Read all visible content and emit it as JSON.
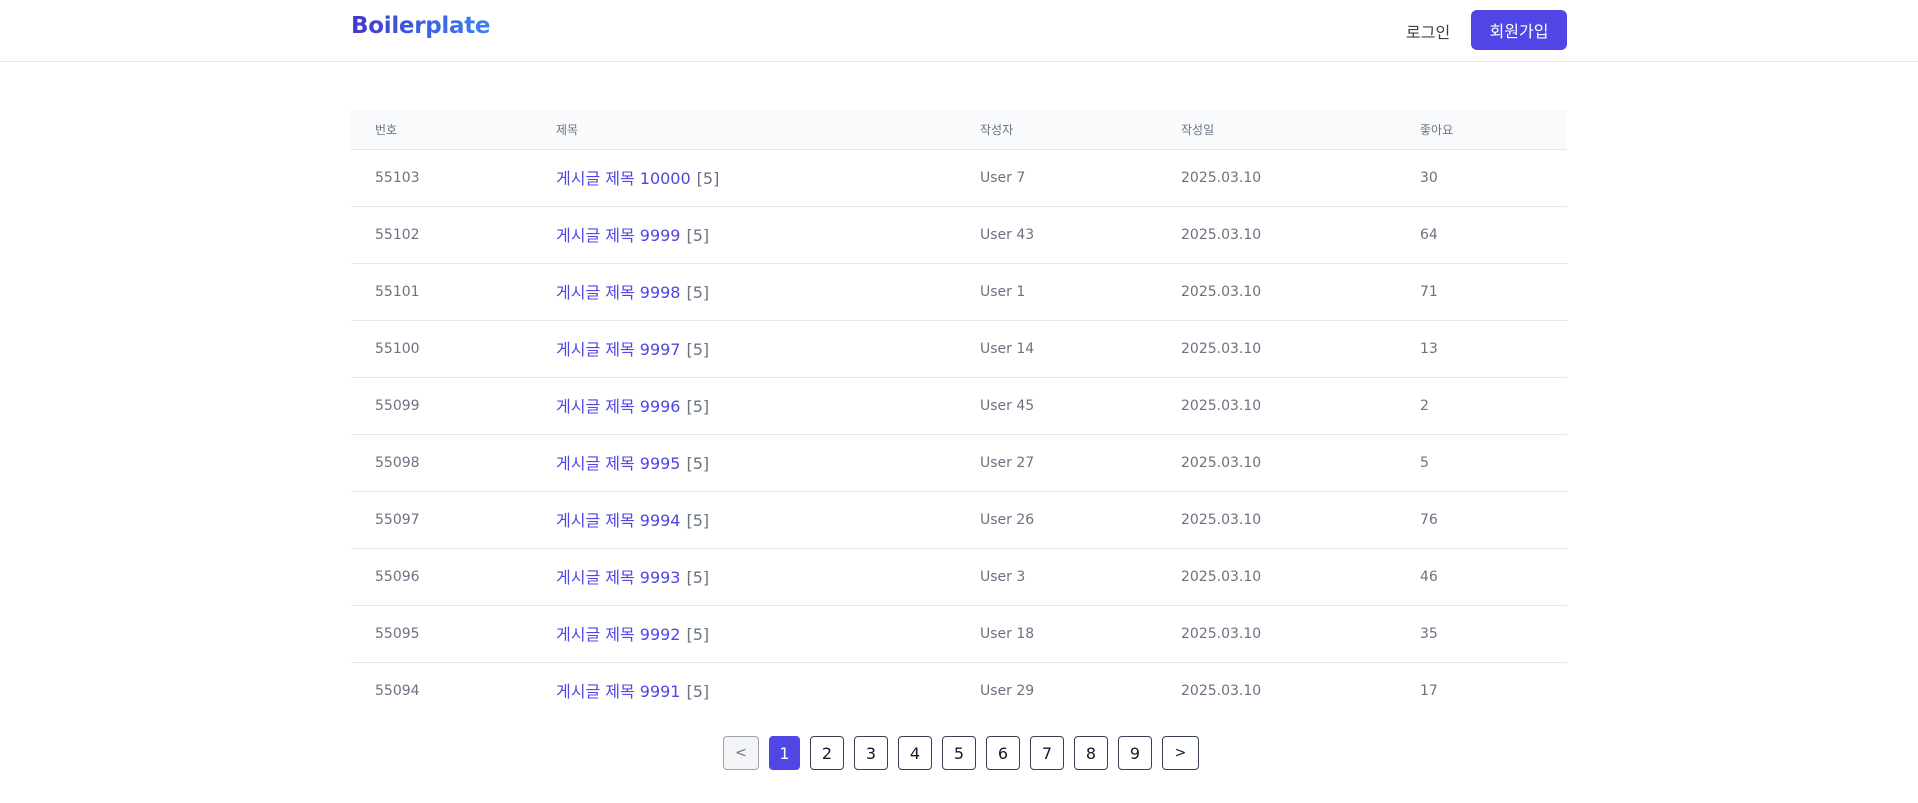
{
  "header": {
    "logo": "Boilerplate",
    "login_label": "로그인",
    "signup_label": "회원가입"
  },
  "table": {
    "columns": [
      "번호",
      "제목",
      "작성자",
      "작성일",
      "좋아요"
    ],
    "rows": [
      {
        "num": "55103",
        "title": "게시글 제목 10000",
        "comments": "[5]",
        "author": "User 7",
        "date": "2025.03.10",
        "likes": "30"
      },
      {
        "num": "55102",
        "title": "게시글 제목 9999",
        "comments": "[5]",
        "author": "User 43",
        "date": "2025.03.10",
        "likes": "64"
      },
      {
        "num": "55101",
        "title": "게시글 제목 9998",
        "comments": "[5]",
        "author": "User 1",
        "date": "2025.03.10",
        "likes": "71"
      },
      {
        "num": "55100",
        "title": "게시글 제목 9997",
        "comments": "[5]",
        "author": "User 14",
        "date": "2025.03.10",
        "likes": "13"
      },
      {
        "num": "55099",
        "title": "게시글 제목 9996",
        "comments": "[5]",
        "author": "User 45",
        "date": "2025.03.10",
        "likes": "2"
      },
      {
        "num": "55098",
        "title": "게시글 제목 9995",
        "comments": "[5]",
        "author": "User 27",
        "date": "2025.03.10",
        "likes": "5"
      },
      {
        "num": "55097",
        "title": "게시글 제목 9994",
        "comments": "[5]",
        "author": "User 26",
        "date": "2025.03.10",
        "likes": "76"
      },
      {
        "num": "55096",
        "title": "게시글 제목 9993",
        "comments": "[5]",
        "author": "User 3",
        "date": "2025.03.10",
        "likes": "46"
      },
      {
        "num": "55095",
        "title": "게시글 제목 9992",
        "comments": "[5]",
        "author": "User 18",
        "date": "2025.03.10",
        "likes": "35"
      },
      {
        "num": "55094",
        "title": "게시글 제목 9991",
        "comments": "[5]",
        "author": "User 29",
        "date": "2025.03.10",
        "likes": "17"
      }
    ]
  },
  "pagination": {
    "prev_label": "<",
    "next_label": ">",
    "pages": [
      "1",
      "2",
      "3",
      "4",
      "5",
      "6",
      "7",
      "8",
      "9"
    ],
    "current": "1"
  },
  "colors": {
    "accent": "#4f46e5",
    "logo_gradient_start": "#4338ca",
    "logo_gradient_end": "#3b82f6",
    "muted_text": "#6b7280",
    "border": "#e5e7eb"
  }
}
